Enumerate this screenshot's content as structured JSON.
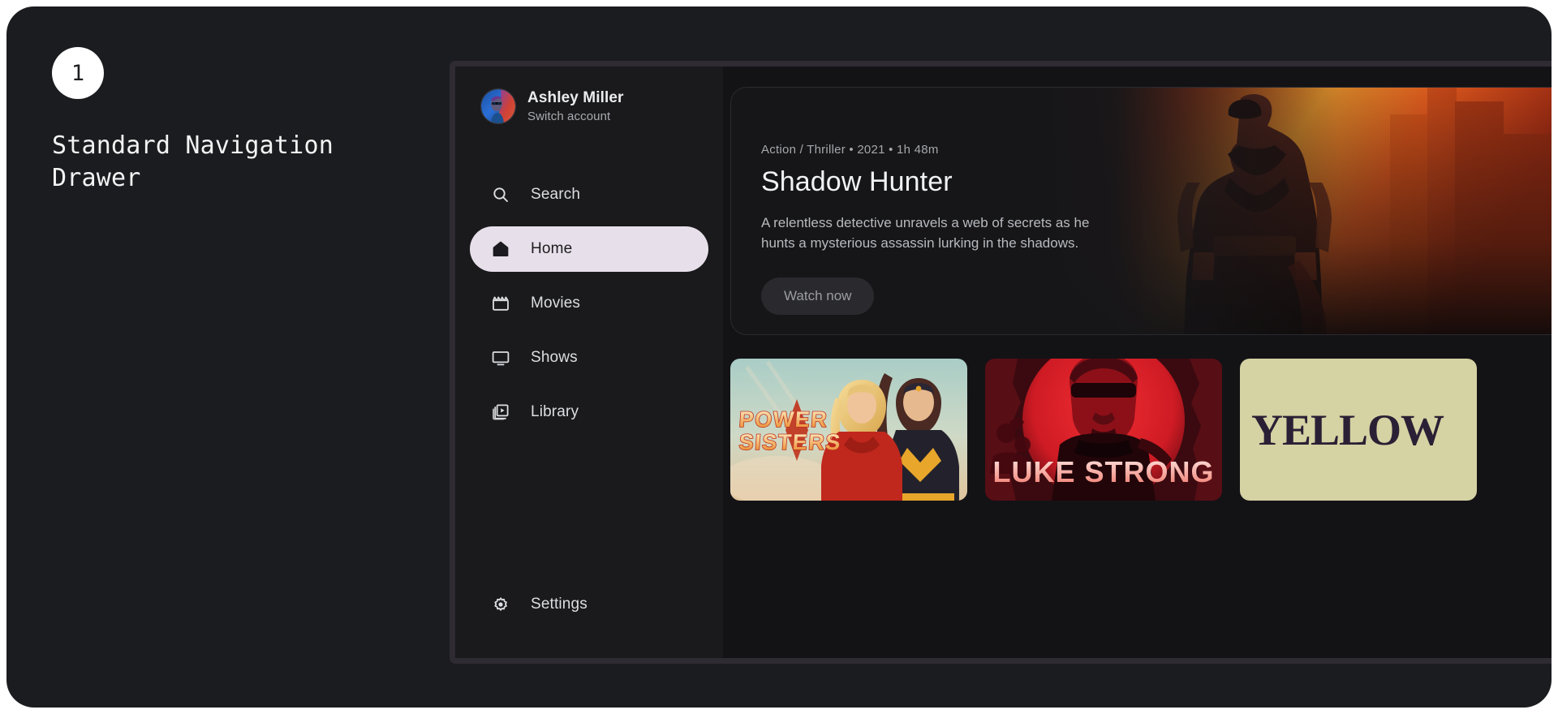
{
  "annotation": {
    "step_number": "1",
    "title": "Standard Navigation\nDrawer"
  },
  "drawer": {
    "account": {
      "name": "Ashley Miller",
      "switch_label": "Switch account",
      "avatar_icon": "user-avatar-portrait"
    },
    "items": [
      {
        "label": "Search",
        "icon": "search-icon",
        "active": false
      },
      {
        "label": "Home",
        "icon": "home-icon",
        "active": true
      },
      {
        "label": "Movies",
        "icon": "clapperboard-icon",
        "active": false
      },
      {
        "label": "Shows",
        "icon": "tv-icon",
        "active": false
      },
      {
        "label": "Library",
        "icon": "video-library-icon",
        "active": false
      }
    ],
    "settings": {
      "label": "Settings",
      "icon": "gear-icon"
    }
  },
  "hero": {
    "meta": "Action / Thriller • 2021 • 1h 48m",
    "title": "Shadow Hunter",
    "description": "A relentless detective unravels a web of secrets as he hunts a mysterious assassin lurking in the shadows.",
    "watch_button": "Watch now",
    "artwork_alt": "superhero-silhouette-orange-sky"
  },
  "cards": [
    {
      "title": "POWER SISTERS",
      "artwork_alt": "two-superheroines-pastel-sky"
    },
    {
      "title": "LUKE STRONG",
      "artwork_alt": "man-sunglasses-red-sun"
    },
    {
      "title": "YELLOW",
      "artwork_alt": "yellow-khaki-serif-title"
    }
  ],
  "colors": {
    "page_background": "#ffffff",
    "canvas_background": "#1b1c1f",
    "device_bezel": "#2f2b33",
    "screen_background": "#131316",
    "drawer_background": "#1a1a1d",
    "active_pill": "#e7e0ea",
    "accent_orange": "#e2622a",
    "accent_red": "#cf2030",
    "card_yellow": "#d5d2a3"
  }
}
